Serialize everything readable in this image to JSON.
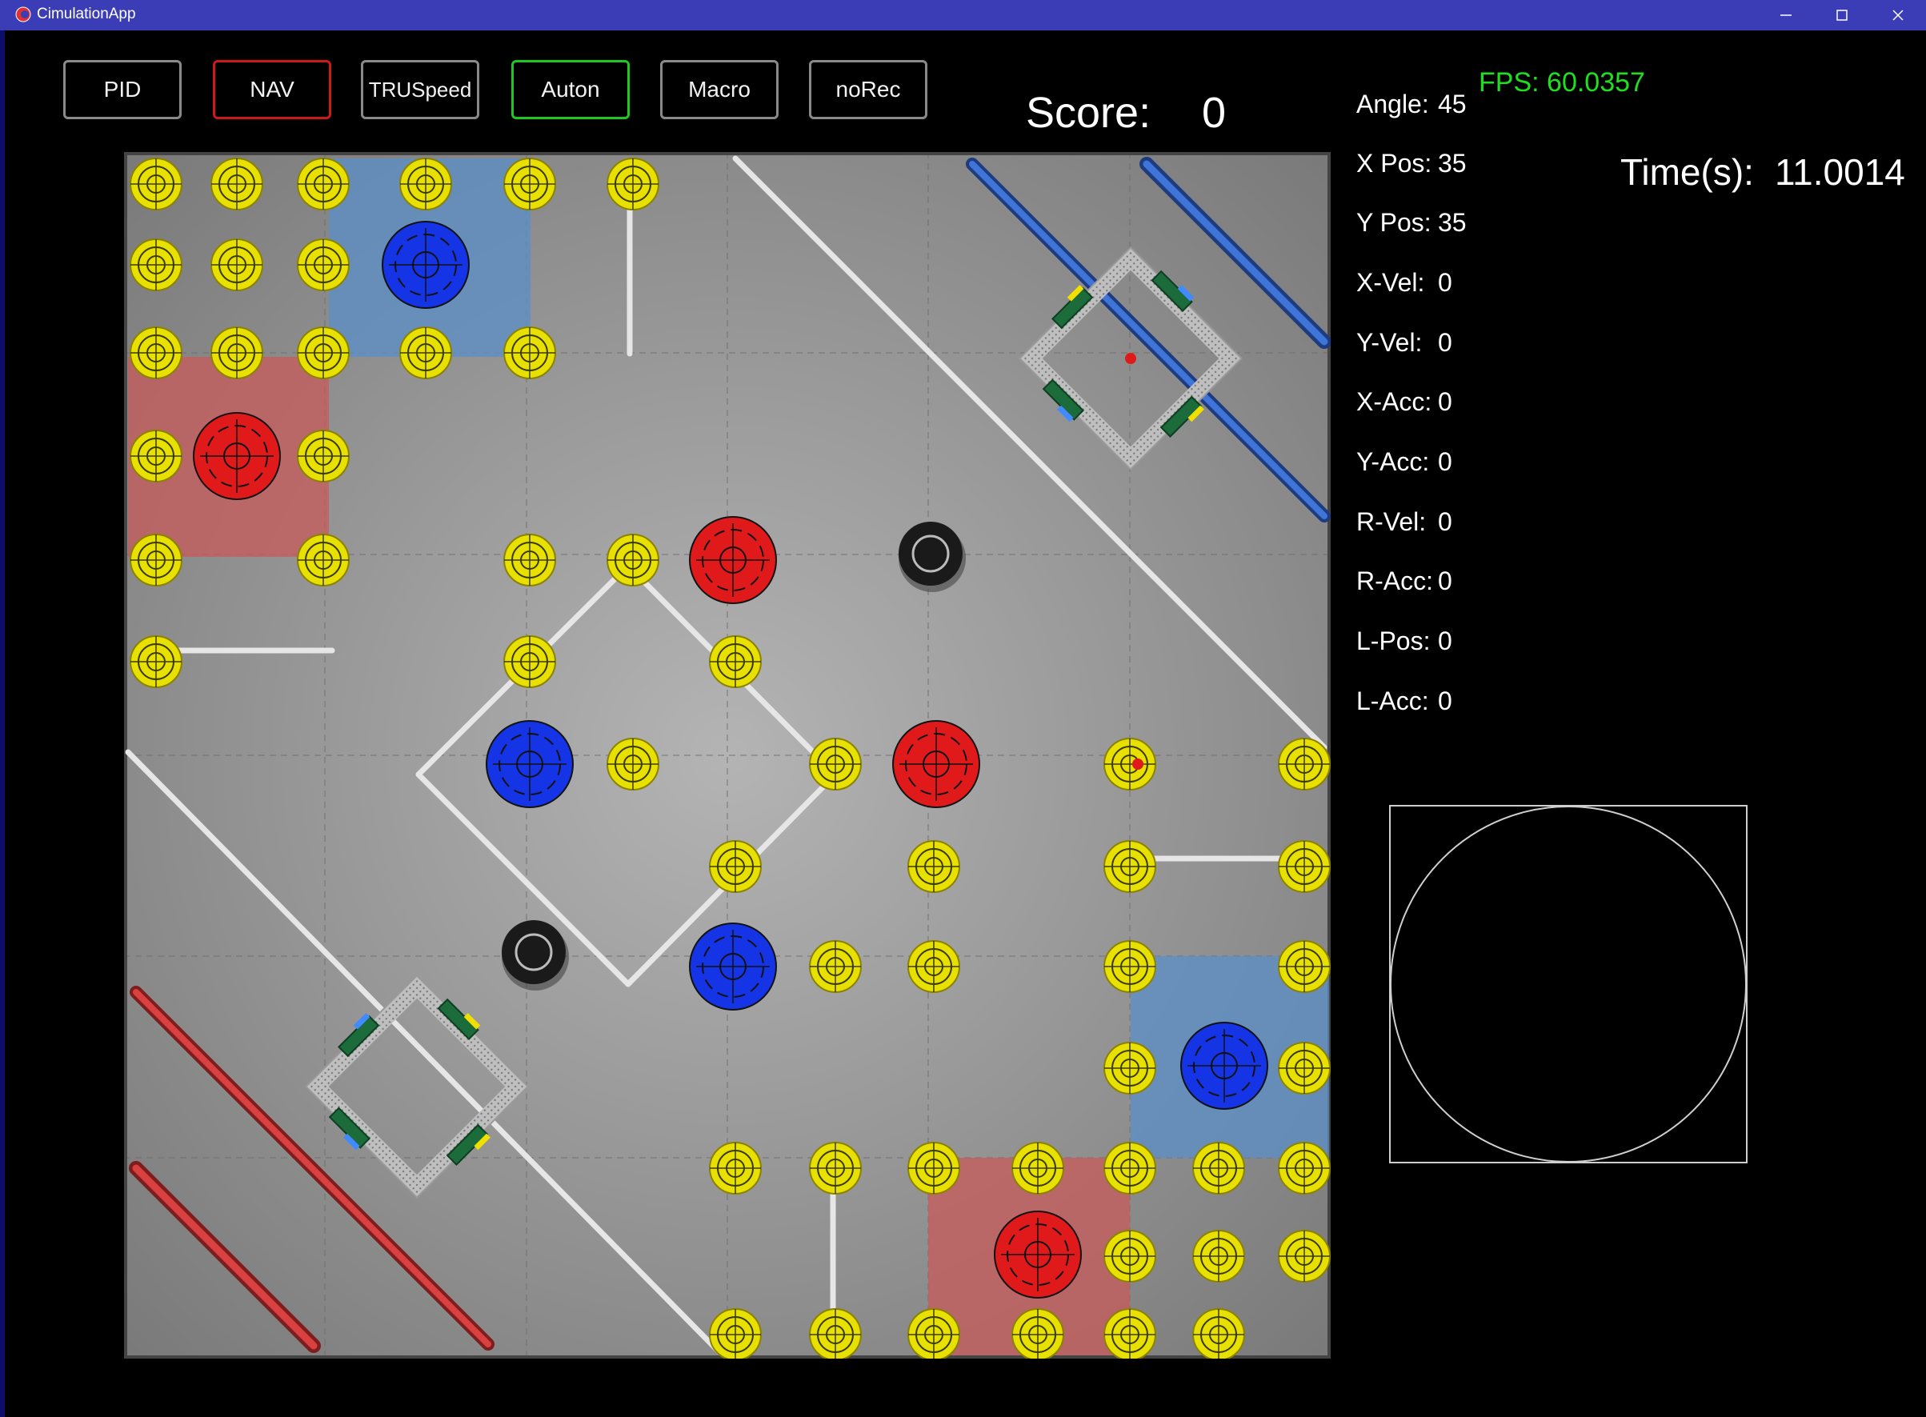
{
  "window": {
    "title": "CimulationApp",
    "controls": [
      "minimize",
      "maximize",
      "close"
    ],
    "titlebar_color": "#3b3db6"
  },
  "toolbar": {
    "buttons": [
      {
        "label": "PID",
        "border": "#8a8a8a"
      },
      {
        "label": "NAV",
        "border": "#cc1a1a"
      },
      {
        "label": "TRUSpeed",
        "border": "#8a8a8a"
      },
      {
        "label": "Auton",
        "border": "#1fc81f"
      },
      {
        "label": "Macro",
        "border": "#8a8a8a"
      },
      {
        "label": "noRec",
        "border": "#8a8a8a"
      }
    ]
  },
  "score": {
    "label": "Score:",
    "value": "0"
  },
  "stats": [
    {
      "label": "Angle:",
      "value": "45"
    },
    {
      "label": "X Pos:",
      "value": "35"
    },
    {
      "label": "Y Pos:",
      "value": "35"
    },
    {
      "label": "X-Vel:",
      "value": "0"
    },
    {
      "label": "Y-Vel:",
      "value": "0"
    },
    {
      "label": "X-Acc:",
      "value": "0"
    },
    {
      "label": "Y-Acc:",
      "value": "0"
    },
    {
      "label": "R-Vel:",
      "value": "0"
    },
    {
      "label": "R-Acc:",
      "value": "0"
    },
    {
      "label": "L-Pos:",
      "value": "0"
    },
    {
      "label": "L-Acc:",
      "value": "0"
    }
  ],
  "fps": {
    "label": "FPS:",
    "value": "60.0357"
  },
  "time": {
    "label": "Time(s):",
    "value": "11.0014"
  },
  "colors": {
    "ring_yellow": "#e8e000",
    "goal_red": "#e01a1a",
    "goal_blue": "#1434e6",
    "zone_red": "#c85a5a",
    "zone_blue": "#5a8fc8",
    "field_gray": "#8c8c8c",
    "line_white": "#e6e6e6"
  }
}
